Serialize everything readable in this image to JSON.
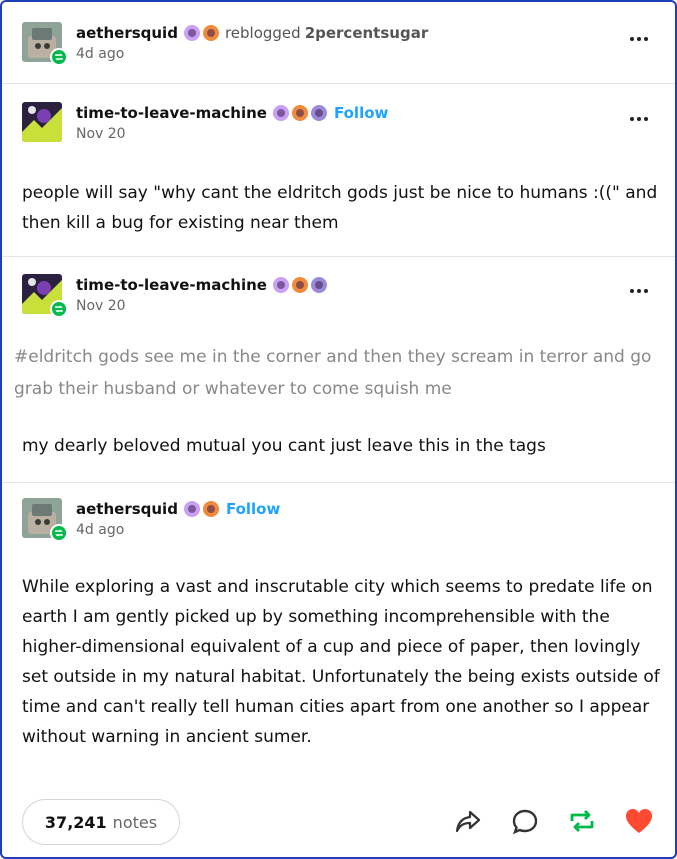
{
  "post": {
    "reblogger": {
      "name": "aethersquid",
      "action": "reblogged",
      "source": "2percentsugar",
      "date": "4d ago"
    },
    "entries": [
      {
        "name": "time-to-leave-machine",
        "follow_label": "Follow",
        "date": "Nov 20",
        "text": "people will say \"why cant the eldritch gods just be nice to humans :((\" and then kill a bug for existing near them"
      },
      {
        "name": "time-to-leave-machine",
        "date": "Nov 20",
        "tags": "#eldritch gods see me in the corner and then they scream in terror and go grab their husband or whatever to come squish me",
        "text": "my dearly beloved mutual you cant just leave this in the tags"
      },
      {
        "name": "aethersquid",
        "follow_label": "Follow",
        "date": "4d ago",
        "text": "While exploring a vast and inscrutable city which seems to predate life on earth I am gently picked up by something incomprehensible with the higher-dimensional equivalent of a cup and piece of paper, then lovingly set outside in my natural habitat. Unfortunately the being exists outside of time and can't really tell human cities apart from one another so I appear without warning in ancient sumer."
      }
    ],
    "footer": {
      "notes_count": "37,241",
      "notes_label": "notes"
    }
  },
  "icons": {
    "reblog_badge": "reblog-icon",
    "more": "more-options-icon",
    "share": "share-icon",
    "reply": "reply-icon",
    "reblog": "reblog-icon",
    "like": "heart-icon"
  },
  "colors": {
    "follow": "#1fa3ff",
    "reblog_green": "#00b94b",
    "heart_red": "#ff4930",
    "frame_border": "#1f3fb5"
  }
}
